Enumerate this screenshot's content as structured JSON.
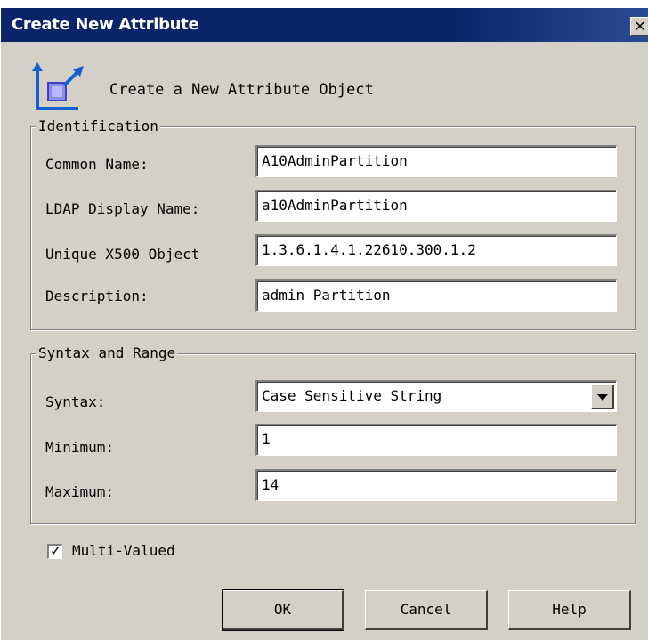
{
  "window": {
    "title": "Create New Attribute",
    "close_glyph": "✕"
  },
  "header": {
    "text": "Create a New Attribute Object",
    "icon": "attribute-wizard-icon"
  },
  "identification": {
    "legend": "Identification",
    "common_name": {
      "label": "Common Name:",
      "value": "A10AdminPartition"
    },
    "ldap_display_name": {
      "label": "LDAP Display Name:",
      "value": "a10AdminPartition"
    },
    "unique_x500": {
      "label": "Unique X500 Object",
      "value": "1.3.6.1.4.1.22610.300.1.2"
    },
    "description": {
      "label": "Description:",
      "value": "admin Partition"
    }
  },
  "syntax_range": {
    "legend": "Syntax and Range",
    "syntax": {
      "label": "Syntax:",
      "value": "Case Sensitive String"
    },
    "minimum": {
      "label": "Minimum:",
      "value": "1"
    },
    "maximum": {
      "label": "Maximum:",
      "value": "14"
    }
  },
  "multi_valued": {
    "label": "Multi-Valued",
    "checked": true,
    "check_glyph": "✓"
  },
  "buttons": {
    "ok": "OK",
    "cancel": "Cancel",
    "help": "Help"
  },
  "colors": {
    "titlebar": "#0a246a",
    "face": "#d4d0c8"
  }
}
